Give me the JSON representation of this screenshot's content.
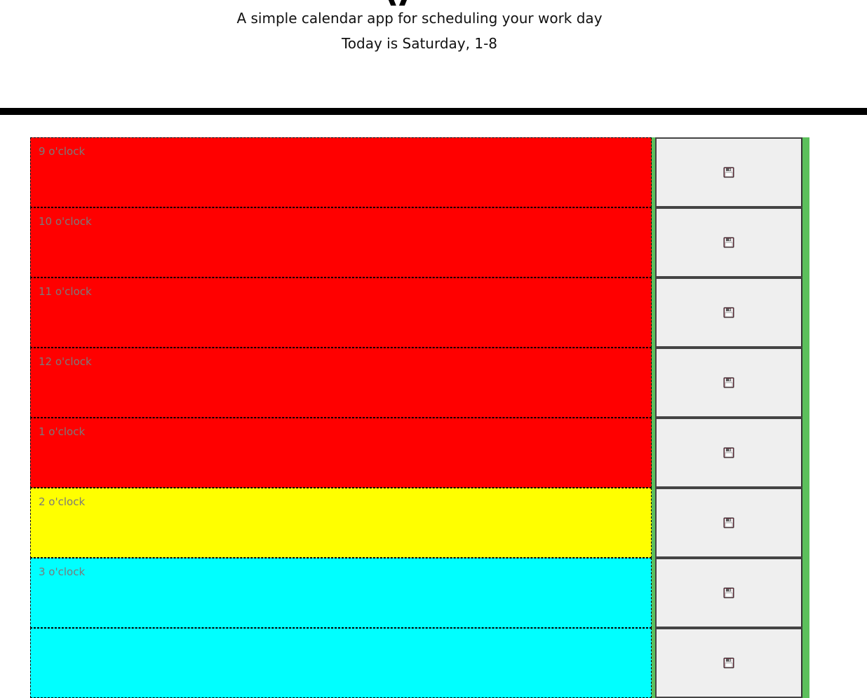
{
  "header": {
    "title_visible_fragment": "y",
    "subtitle": "A simple calendar app for scheduling your work day",
    "today": "Today is Saturday, 1-8"
  },
  "colors": {
    "past": "#ff0000",
    "present": "#ffff00",
    "future": "#00ffff",
    "accent": "#5cc05c",
    "divider": "#000000"
  },
  "schedule": {
    "rows": [
      {
        "label": "9 o'clock",
        "state": "past",
        "save_icon": "floppy-disk-icon"
      },
      {
        "label": "10 o'clock",
        "state": "past",
        "save_icon": "floppy-disk-icon"
      },
      {
        "label": "11 o'clock",
        "state": "past",
        "save_icon": "floppy-disk-icon"
      },
      {
        "label": "12 o'clock",
        "state": "past",
        "save_icon": "floppy-disk-icon"
      },
      {
        "label": "1 o'clock",
        "state": "past",
        "save_icon": "floppy-disk-icon"
      },
      {
        "label": "2 o'clock",
        "state": "present",
        "save_icon": "floppy-disk-icon"
      },
      {
        "label": "3 o'clock",
        "state": "future",
        "save_icon": "floppy-disk-icon"
      },
      {
        "label": "",
        "state": "future",
        "save_icon": "floppy-disk-icon"
      }
    ]
  }
}
